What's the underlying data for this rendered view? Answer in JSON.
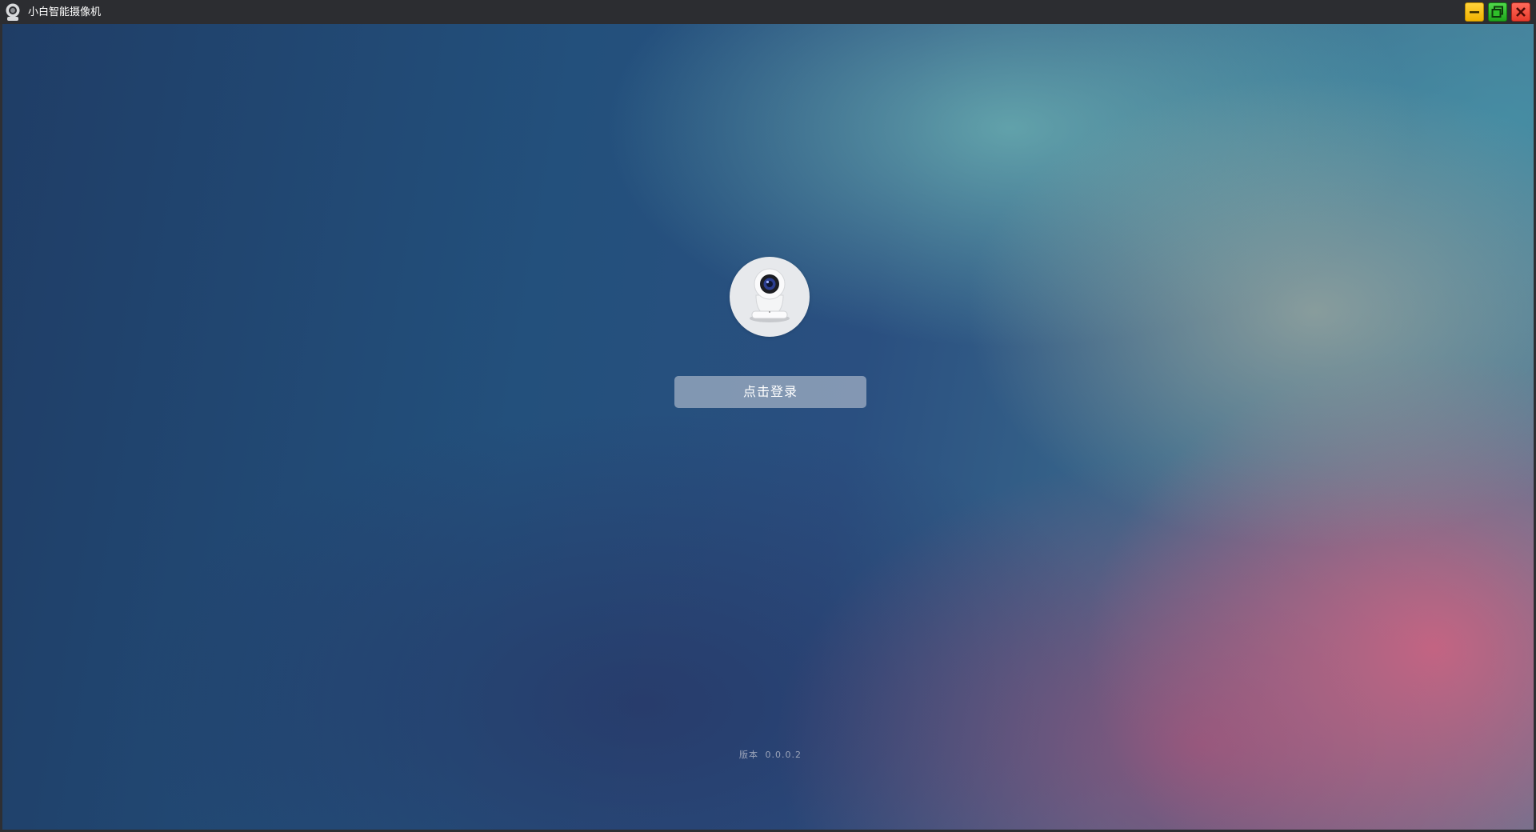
{
  "window": {
    "title": "小白智能摄像机",
    "app_icon": "webcam-icon",
    "controls": {
      "minimize": "minimize-icon",
      "maximize": "maximize-icon",
      "close": "close-icon"
    }
  },
  "login": {
    "avatar_icon": "security-camera-icon",
    "button_label": "点击登录"
  },
  "footer": {
    "version_label": "版本",
    "version_value": "0.0.0.2"
  },
  "colors": {
    "minimize": "#f2b200",
    "maximize": "#1fa51b",
    "close": "#e83c2d"
  }
}
